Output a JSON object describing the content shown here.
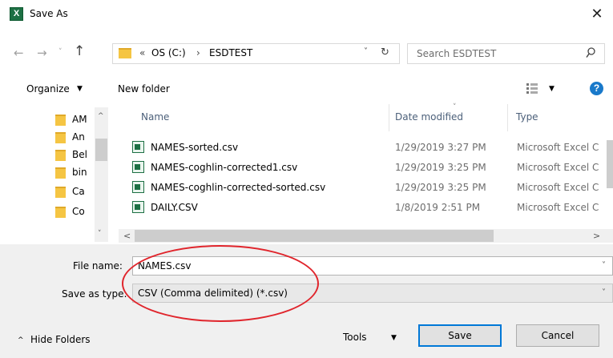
{
  "window": {
    "title": "Save As",
    "app_icon_letter": "X",
    "close_glyph": "✕"
  },
  "nav": {
    "back_glyph": "←",
    "forward_glyph": "→",
    "recent_glyph": "˅",
    "up_glyph": "↑",
    "address": {
      "chevron": "«",
      "part1": "OS (C:)",
      "separator": "›",
      "part2": "ESDTEST",
      "dropdown_glyph": "˅",
      "refresh_glyph": "↻"
    },
    "search": {
      "placeholder": "Search ESDTEST"
    }
  },
  "toolbar": {
    "organize_label": "Organize",
    "dropdown_glyph": "▼",
    "new_folder_label": "New folder",
    "help_glyph": "?"
  },
  "tree": {
    "items": [
      {
        "label": "AM"
      },
      {
        "label": "An"
      },
      {
        "label": "Bel"
      },
      {
        "label": "bin"
      },
      {
        "label": "Ca"
      },
      {
        "label": "Co"
      }
    ],
    "up_glyph": "^",
    "down_glyph": "˅"
  },
  "list": {
    "columns": {
      "name": "Name",
      "date": "Date modified",
      "type": "Type"
    },
    "sort_glyph": "˅",
    "files": [
      {
        "name": "NAMES-sorted.csv",
        "date": "1/29/2019 3:27 PM",
        "type": "Microsoft Excel C"
      },
      {
        "name": "NAMES-coghlin-corrected1.csv",
        "date": "1/29/2019 3:25 PM",
        "type": "Microsoft Excel C"
      },
      {
        "name": "NAMES-coghlin-corrected-sorted.csv",
        "date": "1/29/2019 3:25 PM",
        "type": "Microsoft Excel C"
      },
      {
        "name": "DAILY.CSV",
        "date": "1/8/2019 2:51 PM",
        "type": "Microsoft Excel C"
      }
    ],
    "hscroll": {
      "left_glyph": "<",
      "right_glyph": ">"
    }
  },
  "form": {
    "filename_label": "File name:",
    "filename_value": "NAMES.csv",
    "savetype_label": "Save as type:",
    "savetype_value": "CSV (Comma delimited) (*.csv)",
    "dropdown_glyph": "˅"
  },
  "footer": {
    "hide_folders_label": "Hide Folders",
    "hide_glyph": "^",
    "tools_label": "Tools",
    "tools_glyph": "▼",
    "save_label": "Save",
    "cancel_label": "Cancel"
  },
  "colors": {
    "accent": "#0078d7",
    "annotation": "#e0252c",
    "excel_green": "#1d7044"
  }
}
